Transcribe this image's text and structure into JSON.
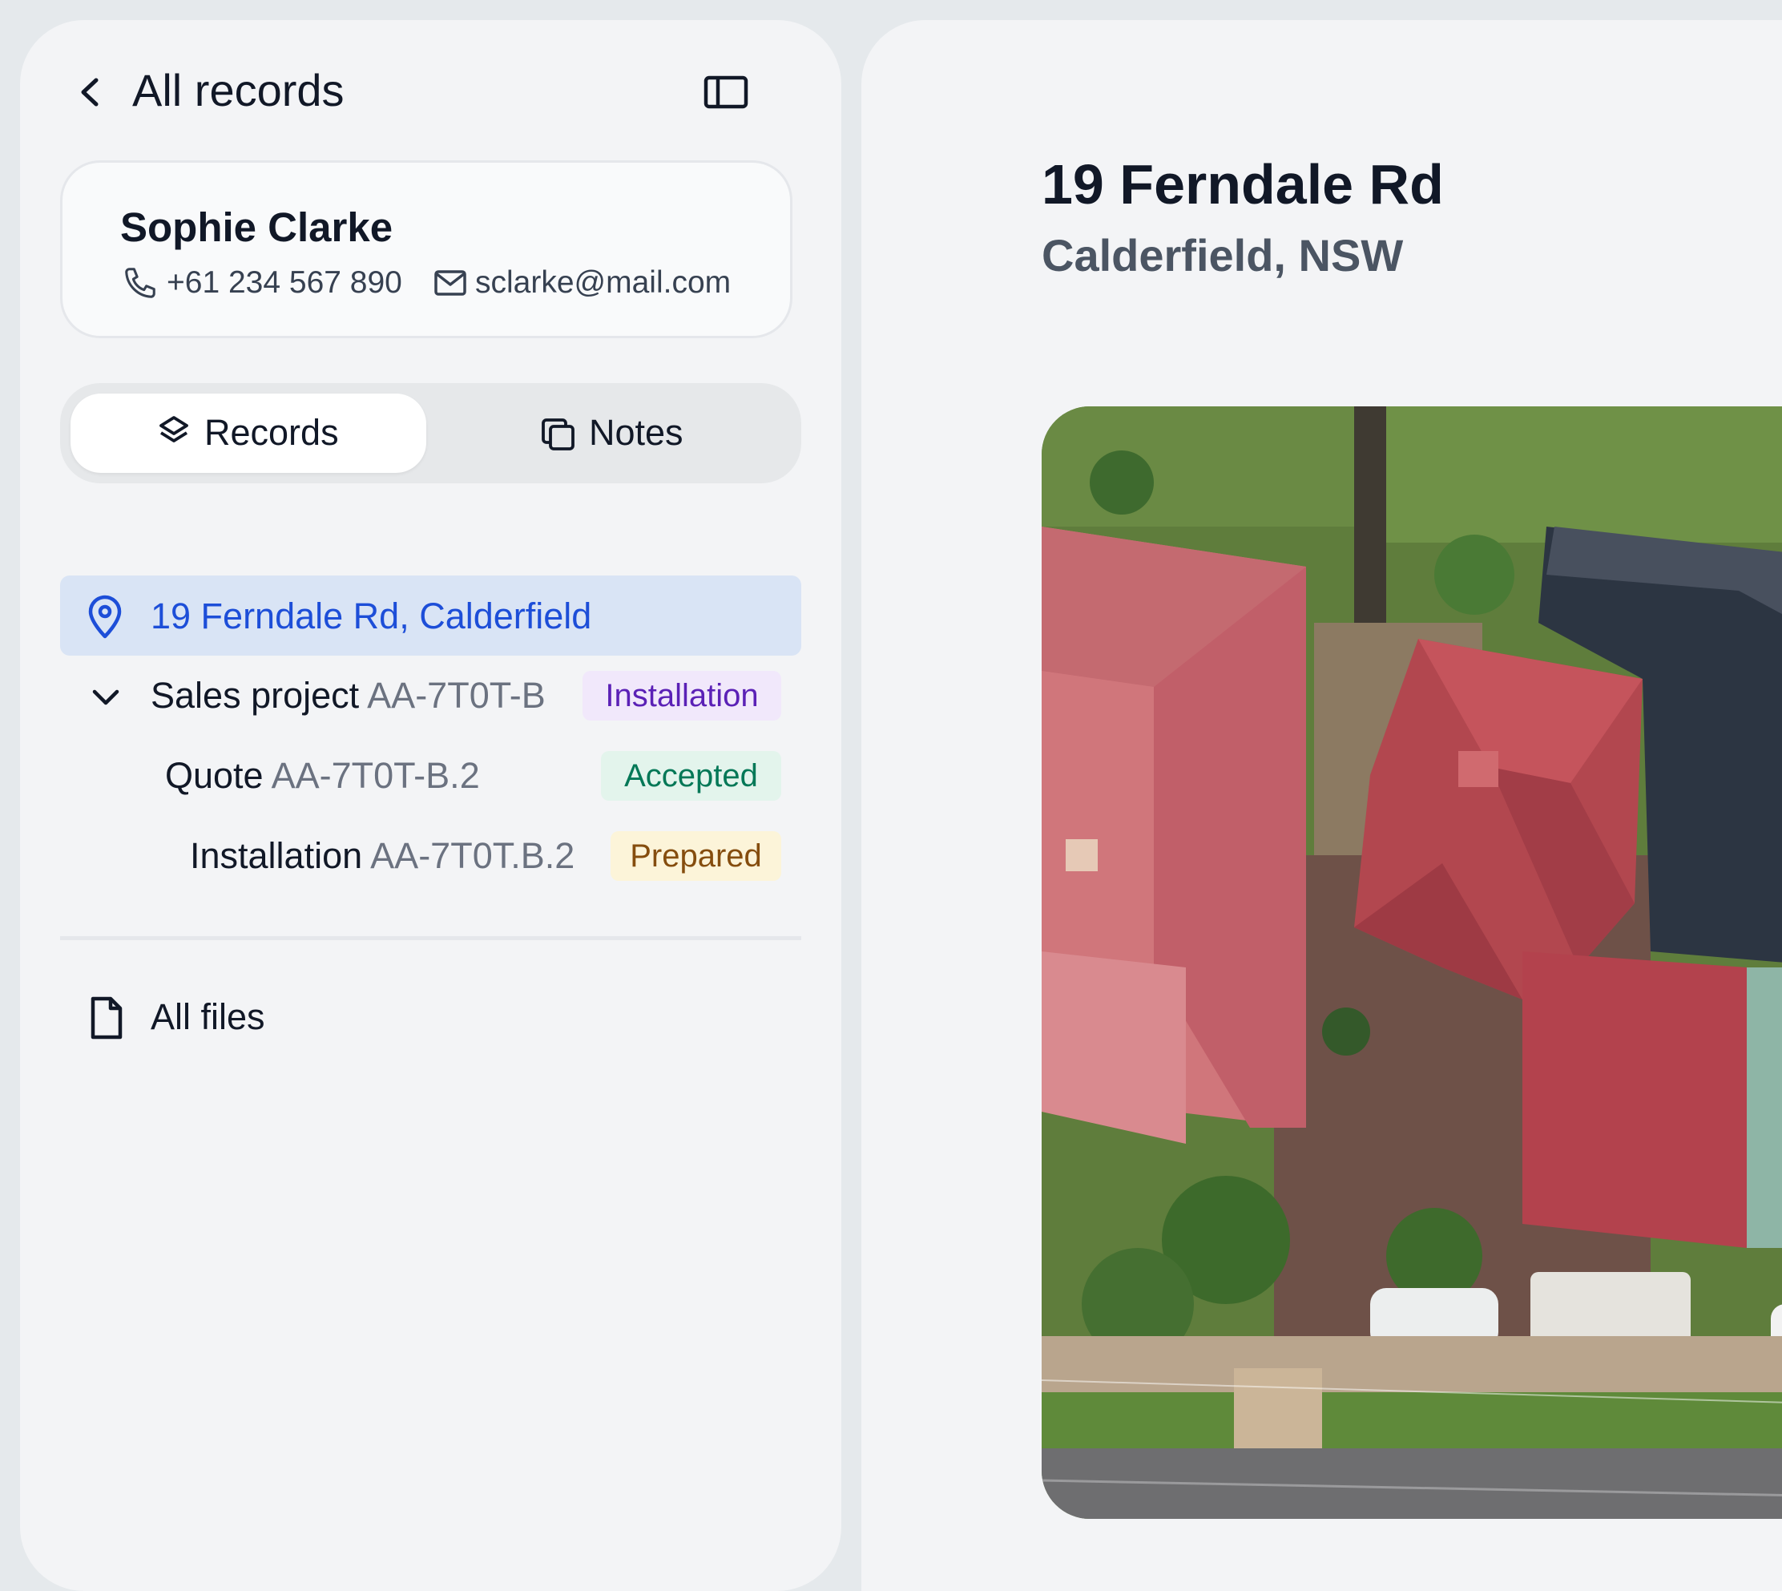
{
  "header": {
    "title": "All records"
  },
  "contact": {
    "name": "Sophie Clarke",
    "phone": "+61 234 567 890",
    "email": "sclarke@mail.com"
  },
  "tabs": [
    {
      "label": "Records",
      "active": true,
      "icon": "layers-icon"
    },
    {
      "label": "Notes",
      "active": false,
      "icon": "notes-icon"
    }
  ],
  "records": {
    "location": "19 Ferndale Rd, Calderfield",
    "items": [
      {
        "title": "Sales project",
        "code": "AA-7T0T-B",
        "badge": "Installation",
        "expanded": true
      },
      {
        "title": "Quote",
        "code": "AA-7T0T-B.2",
        "badge": "Accepted"
      },
      {
        "title": "Installation",
        "code": "AA-7T0T.B.2",
        "badge": "Prepared"
      }
    ]
  },
  "files": {
    "label": "All files"
  },
  "property": {
    "title": "19 Ferndale Rd",
    "subtitle": "Calderfield, NSW"
  },
  "colors": {
    "accent": "#1d4ed8",
    "selected_bg": "#d9e4f5",
    "badge_installation": "#f1e8fb",
    "badge_accepted": "#e3f4ec",
    "badge_prepared": "#fcf4d9"
  }
}
